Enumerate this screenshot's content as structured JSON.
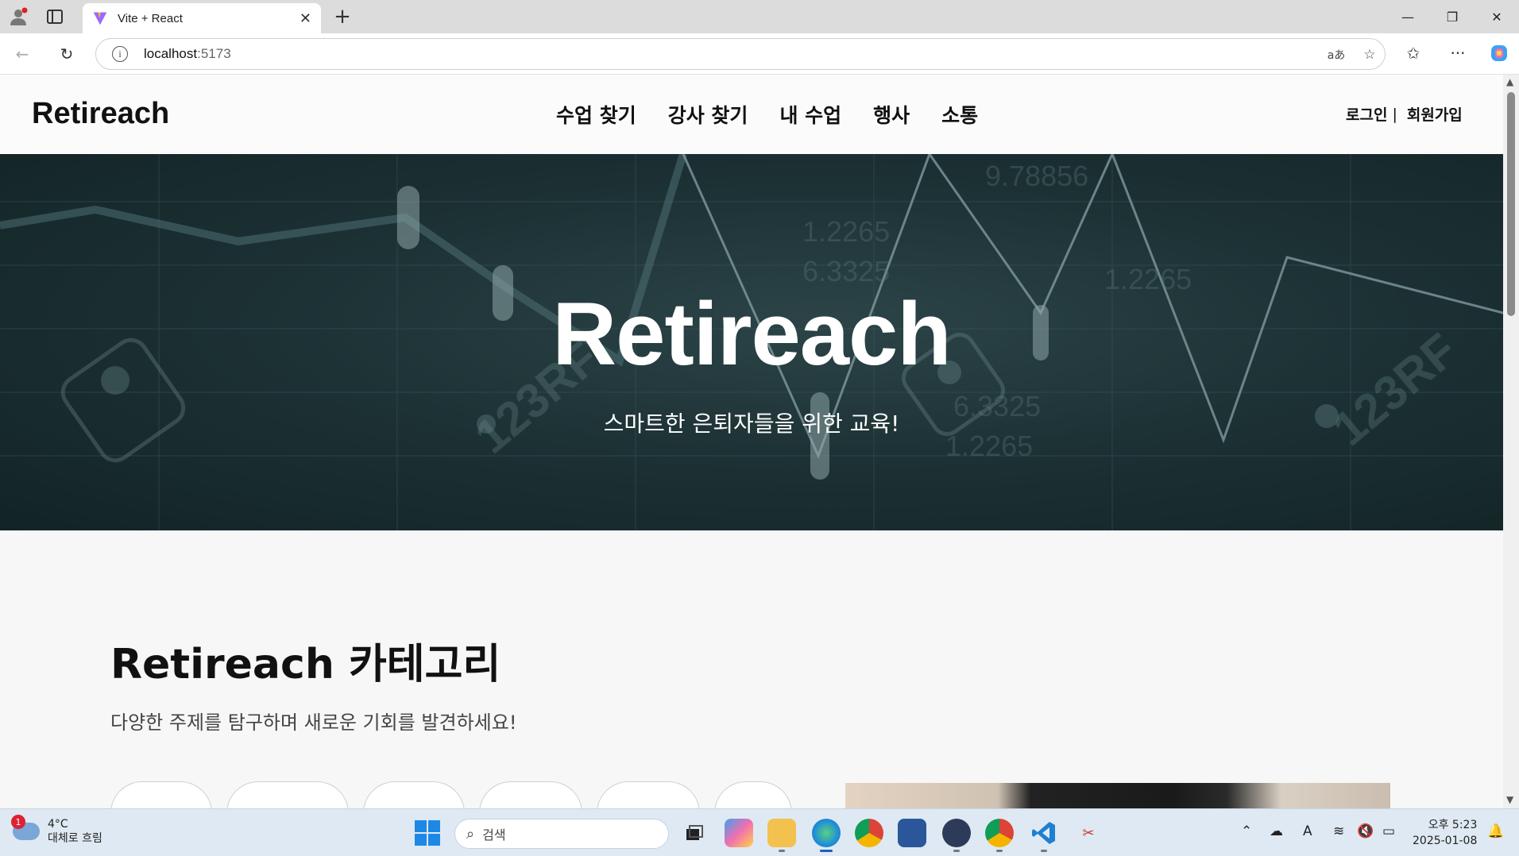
{
  "browser": {
    "tab_title": "Vite + React",
    "url_host": "localhost",
    "url_port": ":5173",
    "translate_icon_label": "aあ"
  },
  "site": {
    "logo": "Retireach",
    "nav": [
      "수업 찾기",
      "강사 찾기",
      "내 수업",
      "행사",
      "소통"
    ],
    "login": "로그인",
    "separator": "|",
    "signup": "회원가입"
  },
  "hero": {
    "title": "Retireach",
    "subtitle": "스마트한 은퇴자들을 위한 교육!"
  },
  "categories": {
    "title": "Retireach 카테고리",
    "description": "다양한 주제를 탐구하며 새로운 기회를 발견하세요!",
    "pills": [
      "",
      "",
      "",
      "",
      "",
      ""
    ]
  },
  "taskbar": {
    "weather_temp": "4°C",
    "weather_desc": "대체로 흐림",
    "weather_badge": "1",
    "search_placeholder": "검색",
    "time": "오후 5:23",
    "date": "2025-01-08"
  },
  "colors": {
    "hero_bg": "#1d3235",
    "start_blue": "#1e88e5",
    "vscode_blue": "#1f7fd1"
  }
}
